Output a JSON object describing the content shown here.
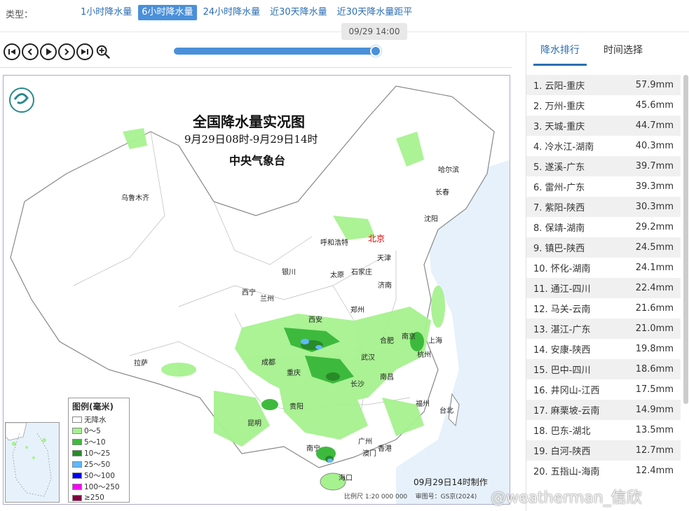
{
  "toolbar": {
    "type_label": "类型：",
    "tabs": [
      {
        "label": "1小时降水量",
        "active": false
      },
      {
        "label": "6小时降水量",
        "active": true
      },
      {
        "label": "24小时降水量",
        "active": false
      },
      {
        "label": "近30天降水量",
        "active": false
      },
      {
        "label": "近30天降水量距平",
        "active": false
      }
    ],
    "time_value": "09/29 14:00",
    "accent": "#4a90d9"
  },
  "map": {
    "title": "全国降水量实况图",
    "subtitle": "9月29日08时-9月29日14时",
    "org": "中央气象台",
    "made": "09月29日14时制作",
    "scale": "比例尺 1:20 000 000",
    "review": "审图号：GS京(2024)",
    "cities": [
      {
        "name": "乌鲁木齐"
      },
      {
        "name": "哈尔滨"
      },
      {
        "name": "长春"
      },
      {
        "name": "沈阳"
      },
      {
        "name": "呼和浩特"
      },
      {
        "name": "北京"
      },
      {
        "name": "天津"
      },
      {
        "name": "银川"
      },
      {
        "name": "太原"
      },
      {
        "name": "石家庄"
      },
      {
        "name": "西宁"
      },
      {
        "name": "兰州"
      },
      {
        "name": "济南"
      },
      {
        "name": "郑州"
      },
      {
        "name": "西安"
      },
      {
        "name": "合肥"
      },
      {
        "name": "南京"
      },
      {
        "name": "上海"
      },
      {
        "name": "拉萨"
      },
      {
        "name": "成都"
      },
      {
        "name": "武汉"
      },
      {
        "name": "杭州"
      },
      {
        "name": "重庆"
      },
      {
        "name": "长沙"
      },
      {
        "name": "南昌"
      },
      {
        "name": "贵阳"
      },
      {
        "name": "福州"
      },
      {
        "name": "台北"
      },
      {
        "name": "昆明"
      },
      {
        "name": "南宁"
      },
      {
        "name": "广州"
      },
      {
        "name": "香港"
      },
      {
        "name": "澳门"
      },
      {
        "name": "海口"
      }
    ],
    "legend": {
      "title": "图例(毫米)",
      "items": [
        {
          "label": "无降水",
          "color": "#ffffff"
        },
        {
          "label": "0～5",
          "color": "#a6f28f"
        },
        {
          "label": "5～10",
          "color": "#3dba3d"
        },
        {
          "label": "10～25",
          "color": "#288a28"
        },
        {
          "label": "25～50",
          "color": "#61b8ff"
        },
        {
          "label": "50～100",
          "color": "#0000ff"
        },
        {
          "label": "100～250",
          "color": "#fa00fa"
        },
        {
          "label": "≥250",
          "color": "#800040"
        }
      ]
    }
  },
  "panel": {
    "tabs": [
      {
        "label": "降水排行",
        "active": true
      },
      {
        "label": "时间选择",
        "active": false
      }
    ],
    "rankings": [
      {
        "place": "1. 云阳-重庆",
        "value": "57.9mm"
      },
      {
        "place": "2. 万州-重庆",
        "value": "45.6mm"
      },
      {
        "place": "3. 天城-重庆",
        "value": "44.7mm"
      },
      {
        "place": "4. 冷水江-湖南",
        "value": "40.3mm"
      },
      {
        "place": "5. 遂溪-广东",
        "value": "39.7mm"
      },
      {
        "place": "6. 雷州-广东",
        "value": "39.3mm"
      },
      {
        "place": "7. 紫阳-陕西",
        "value": "30.3mm"
      },
      {
        "place": "8. 保靖-湖南",
        "value": "29.2mm"
      },
      {
        "place": "9. 镇巴-陕西",
        "value": "24.5mm"
      },
      {
        "place": "10. 怀化-湖南",
        "value": "24.1mm"
      },
      {
        "place": "11. 通江-四川",
        "value": "22.4mm"
      },
      {
        "place": "12. 马关-云南",
        "value": "21.6mm"
      },
      {
        "place": "13. 湛江-广东",
        "value": "21.0mm"
      },
      {
        "place": "14. 安康-陕西",
        "value": "19.8mm"
      },
      {
        "place": "15. 巴中-四川",
        "value": "18.6mm"
      },
      {
        "place": "16. 井冈山-江西",
        "value": "17.5mm"
      },
      {
        "place": "17. 麻栗坡-云南",
        "value": "14.9mm"
      },
      {
        "place": "18. 巴东-湖北",
        "value": "13.5mm"
      },
      {
        "place": "19. 白河-陕西",
        "value": "12.7mm"
      },
      {
        "place": "20. 五指山-海南",
        "value": "12.4mm"
      }
    ]
  },
  "watermark": "@weatherman_信欣"
}
